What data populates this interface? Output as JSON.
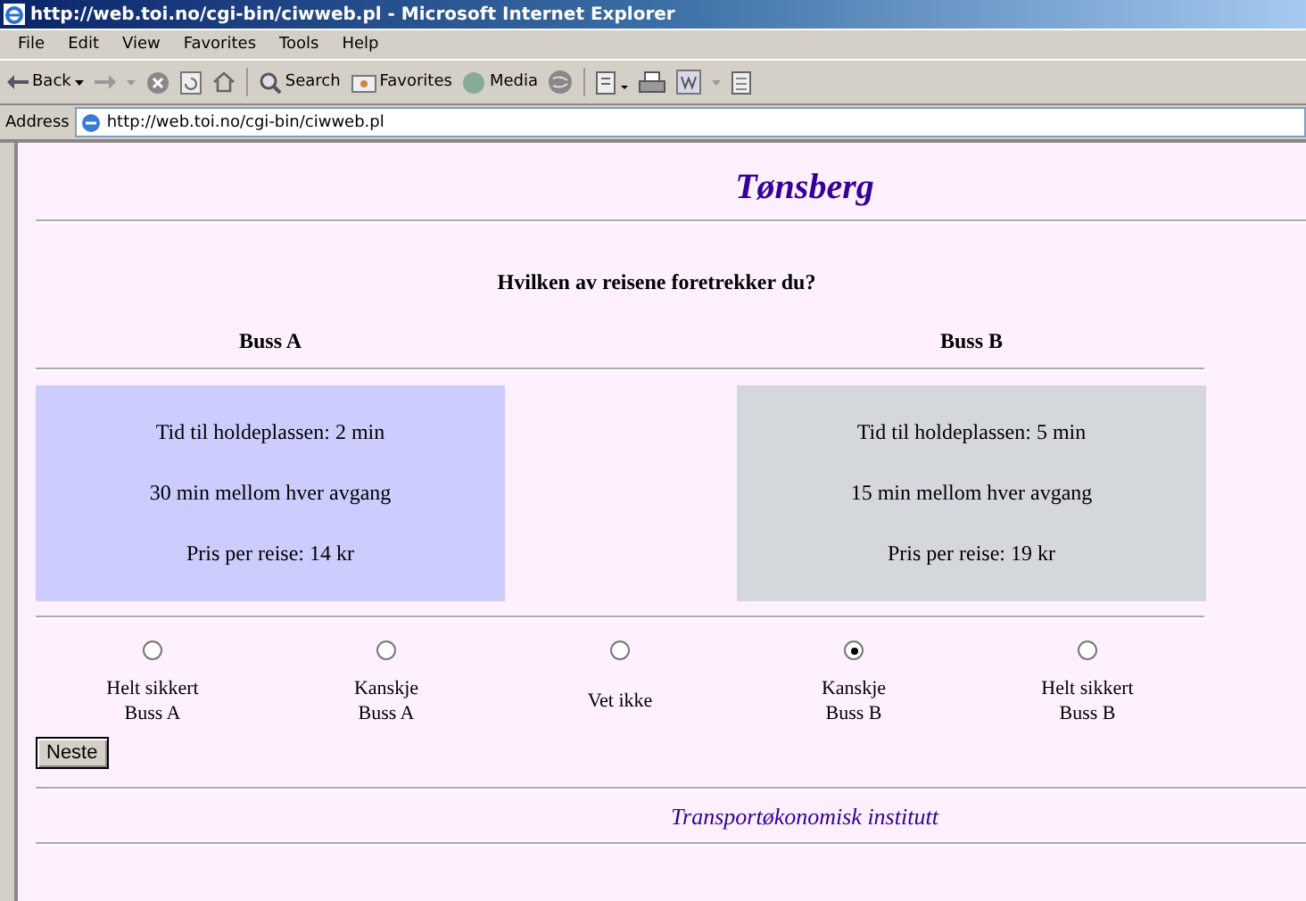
{
  "window": {
    "title": "http://web.toi.no/cgi-bin/ciwweb.pl - Microsoft Internet Explorer"
  },
  "menu": [
    "File",
    "Edit",
    "View",
    "Favorites",
    "Tools",
    "Help"
  ],
  "toolbar": {
    "back": "Back",
    "search": "Search",
    "favorites": "Favorites",
    "media": "Media"
  },
  "address": {
    "label": "Address",
    "value": "http://web.toi.no/cgi-bin/ciwweb.pl"
  },
  "page": {
    "heading": "Tønsberg",
    "question": "Hvilken av reisene foretrekker du?",
    "options": [
      {
        "name": "Buss A",
        "color": "#ccccff",
        "lines": [
          "Tid til holdeplassen: 2 min",
          "30 min mellom hver avgang",
          "Pris per reise: 14 kr"
        ]
      },
      {
        "name": "Buss B",
        "color": "#d4d8dc",
        "lines": [
          "Tid til holdeplassen: 5 min",
          "15 min mellom hver avgang",
          "Pris per reise: 19 kr"
        ]
      }
    ],
    "choices": [
      {
        "lines": [
          "Helt sikkert",
          "Buss A"
        ],
        "selected": false
      },
      {
        "lines": [
          "Kanskje",
          "Buss A"
        ],
        "selected": false
      },
      {
        "lines": [
          "Vet ikke"
        ],
        "selected": false
      },
      {
        "lines": [
          "Kanskje",
          "Buss B"
        ],
        "selected": true
      },
      {
        "lines": [
          "Helt sikkert",
          "Buss B"
        ],
        "selected": false
      }
    ],
    "button": "Neste",
    "footer": "Transportøkonomisk institutt"
  }
}
